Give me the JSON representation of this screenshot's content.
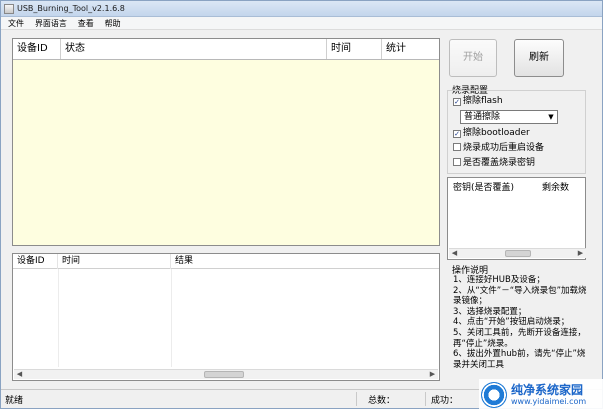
{
  "window": {
    "title": "USB_Burning_Tool_v2.1.6.8"
  },
  "menu": {
    "items": [
      "文件",
      "界面语言",
      "查看",
      "帮助"
    ]
  },
  "device_table": {
    "columns": [
      "设备ID",
      "状态",
      "时间",
      "统计"
    ]
  },
  "log_table": {
    "columns": [
      "设备ID",
      "时间",
      "结果"
    ]
  },
  "buttons": {
    "start": "开始",
    "refresh": "刷新"
  },
  "config": {
    "title": "烧录配置",
    "erase_flash": {
      "label": "擦除flash",
      "checked": true
    },
    "erase_mode": "普通擦除",
    "erase_bootloader": {
      "label": "擦除bootloader",
      "checked": true
    },
    "reboot_after": {
      "label": "烧录成功后重启设备",
      "checked": false
    },
    "overwrite_key": {
      "label": "是否覆盖烧录密钥",
      "checked": false
    }
  },
  "key_table": {
    "columns": [
      "密钥(是否覆盖)",
      "剩余数"
    ]
  },
  "instructions": {
    "title": "操作说明",
    "lines": [
      "1、连接好HUB及设备；",
      "2、从“文件”－“导入烧录包”加载烧录镜像；",
      "3、选择烧录配置；",
      "4、点击“开始”按钮启动烧录；",
      "5、关闭工具前，先断开设备连接，再“停止”烧录。",
      "6、拔出外置hub前，请先“停止”烧录并关闭工具"
    ]
  },
  "status": {
    "state": "就绪",
    "total_label": "总数：",
    "success_label": "成功："
  },
  "watermark": {
    "brand": "纯净系统家园",
    "url": "www.yidaimei.com"
  },
  "check_mark": "✓"
}
